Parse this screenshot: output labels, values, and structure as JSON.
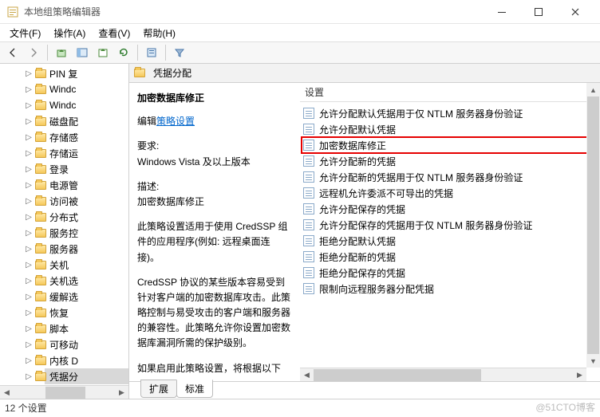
{
  "window": {
    "title": "本地组策略编辑器"
  },
  "menu": {
    "file": "文件(F)",
    "action": "操作(A)",
    "view": "查看(V)",
    "help": "帮助(H)"
  },
  "tree": {
    "items": [
      {
        "label": "PIN 复"
      },
      {
        "label": "Windc"
      },
      {
        "label": "Windc"
      },
      {
        "label": "磁盘配"
      },
      {
        "label": "存储感"
      },
      {
        "label": "存储运"
      },
      {
        "label": "登录"
      },
      {
        "label": "电源管"
      },
      {
        "label": "访问被"
      },
      {
        "label": "分布式"
      },
      {
        "label": "服务控"
      },
      {
        "label": "服务器"
      },
      {
        "label": "关机"
      },
      {
        "label": "关机选"
      },
      {
        "label": "缓解选"
      },
      {
        "label": "恢复"
      },
      {
        "label": "脚本"
      },
      {
        "label": "可移动"
      },
      {
        "label": "内核 D"
      },
      {
        "label": "凭据分",
        "selected": true
      }
    ]
  },
  "header": {
    "title": "凭据分配"
  },
  "desc": {
    "heading": "加密数据库修正",
    "editLabel": "编辑",
    "editLink": "策略设置",
    "reqLabel": "要求:",
    "reqValue": "Windows Vista 及以上版本",
    "descLabel": "描述:",
    "descValue": "加密数据库修正",
    "para1": "此策略设置适用于使用 CredSSP 组件的应用程序(例如: 远程桌面连接)。",
    "para2": "CredSSP 协议的某些版本容易受到针对客户端的加密数据库攻击。此策略控制与易受攻击的客户端和服务器的兼容性。此策略允许你设置加密数据库漏洞所需的保护级别。",
    "para3": "如果启用此策略设置，将根据以下"
  },
  "list": {
    "columnHeader": "设置",
    "items": [
      {
        "label": "允许分配默认凭据用于仅 NTLM 服务器身份验证"
      },
      {
        "label": "允许分配默认凭据"
      },
      {
        "label": "加密数据库修正",
        "highlight": true
      },
      {
        "label": "允许分配新的凭据"
      },
      {
        "label": "允许分配新的凭据用于仅 NTLM 服务器身份验证"
      },
      {
        "label": "远程机允许委派不可导出的凭据"
      },
      {
        "label": "允许分配保存的凭据"
      },
      {
        "label": "允许分配保存的凭据用于仅 NTLM 服务器身份验证"
      },
      {
        "label": "拒绝分配默认凭据"
      },
      {
        "label": "拒绝分配新的凭据"
      },
      {
        "label": "拒绝分配保存的凭据"
      },
      {
        "label": "限制向远程服务器分配凭据"
      }
    ]
  },
  "tabs": {
    "extended": "扩展",
    "standard": "标准"
  },
  "status": {
    "text": "12 个设置"
  },
  "watermark": "@51CTO博客"
}
